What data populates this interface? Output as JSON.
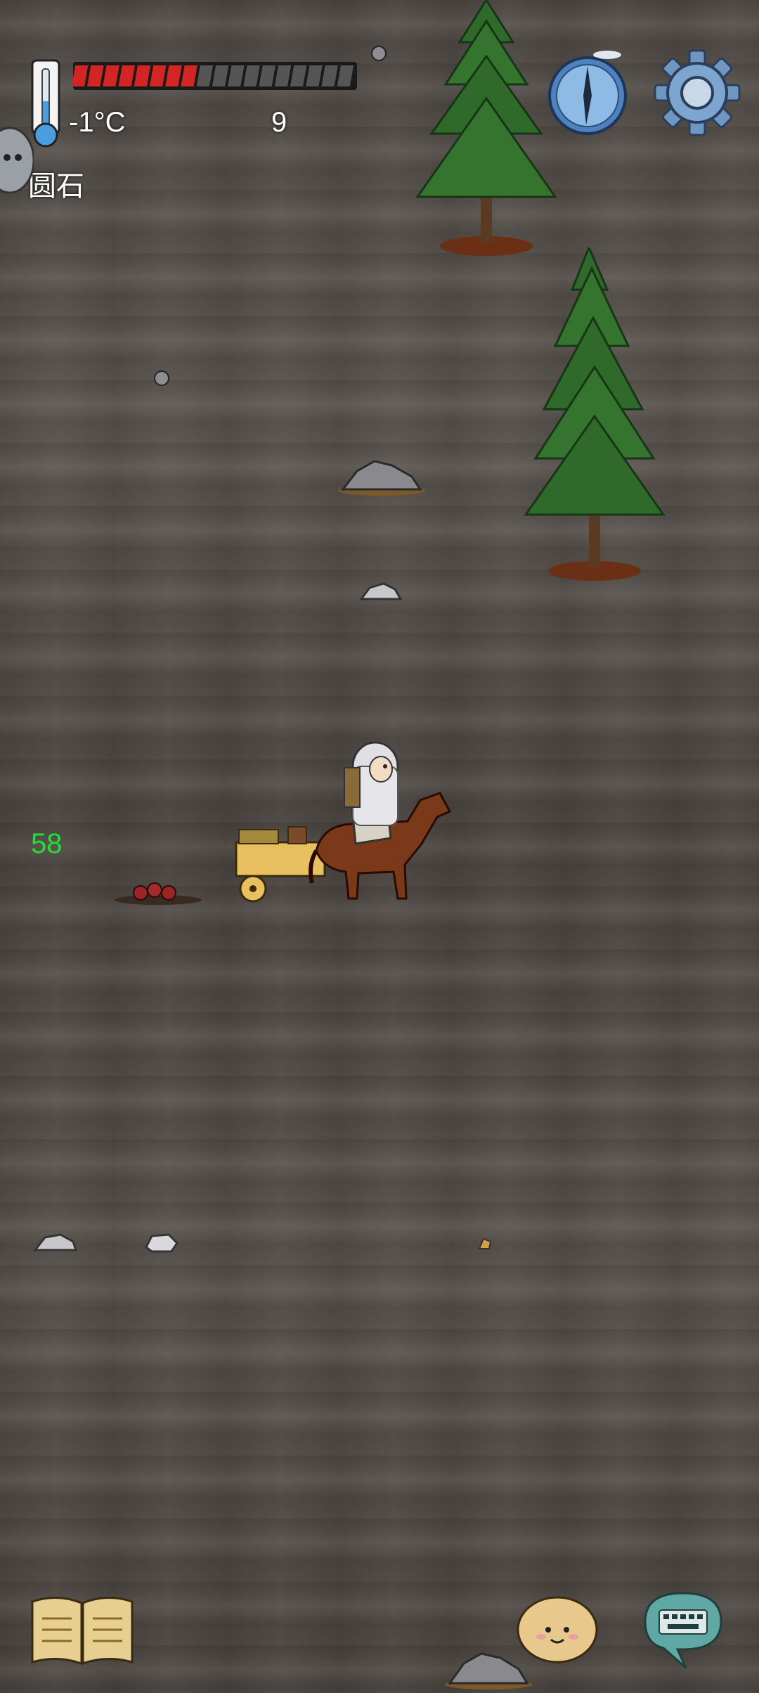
{
  "hud": {
    "temperature": "-1°C",
    "health_number": "9",
    "held_item": "圆石",
    "health_segments_total": 18,
    "health_segments_filled": 8
  },
  "world": {
    "age_label": "58"
  },
  "icons": {
    "thermometer": "thermometer-icon",
    "compass": "compass-icon",
    "settings": "gear-icon",
    "book": "book-icon",
    "emote": "emote-icon",
    "chat": "keyboard-chat-icon"
  },
  "colors": {
    "health_fill": "#d42424",
    "health_empty": "#555555",
    "age_label": "#22e033",
    "ground": "#504a44"
  }
}
